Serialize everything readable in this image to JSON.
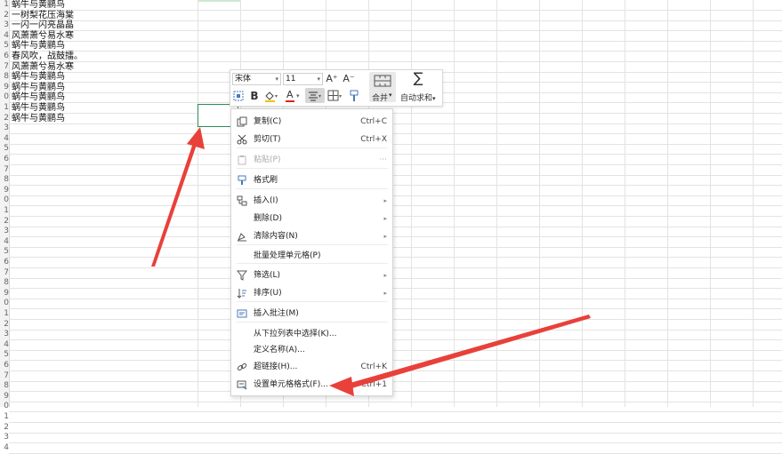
{
  "sheet": {
    "row_numbers": [
      "1",
      "2",
      "3",
      "4",
      "5",
      "6",
      "7",
      "8",
      "9",
      "0",
      "1",
      "2",
      "3",
      "4",
      "5",
      "6",
      "7",
      "8",
      "9",
      "0",
      "1",
      "2",
      "3",
      "4",
      "5",
      "6",
      "7",
      "8",
      "9",
      "0",
      "1",
      "2",
      "3",
      "4",
      "5",
      "6",
      "7",
      "8",
      "9",
      "0",
      "1",
      "2",
      "3",
      "4"
    ],
    "cells": [
      "蜗牛与黄鹂鸟",
      "一树梨花压海棠",
      "一闪一闪亮晶晶",
      "风萧萧兮易水寒",
      "蜗牛与黄鹂鸟",
      "春风吹，战鼓擂。",
      "风萧萧兮易水寒",
      "蜗牛与黄鹂鸟",
      "蜗牛与黄鹂鸟",
      "蜗牛与黄鹂鸟",
      "蜗牛与黄鹂鸟",
      "蜗牛与黄鹂鸟"
    ]
  },
  "minibar": {
    "font_name": "宋体",
    "font_size": "11",
    "increase_font": "A⁺",
    "decrease_font": "A⁻",
    "bold": "B",
    "font_color_letter": "A",
    "merge_label": "合并",
    "autosum_label": "自动求和",
    "sigma": "∑"
  },
  "menu": {
    "items": [
      {
        "label": "复制(C)",
        "shortcut": "Ctrl+C"
      },
      {
        "label": "剪切(T)",
        "shortcut": "Ctrl+X"
      },
      {
        "label": "粘贴(P)",
        "shortcut": "···"
      },
      {
        "label": "格式刷",
        "shortcut": ""
      },
      {
        "label": "插入(I)",
        "shortcut": ""
      },
      {
        "label": "删除(D)",
        "shortcut": ""
      },
      {
        "label": "清除内容(N)",
        "shortcut": ""
      },
      {
        "label": "批量处理单元格(P)",
        "shortcut": ""
      },
      {
        "label": "筛选(L)",
        "shortcut": ""
      },
      {
        "label": "排序(U)",
        "shortcut": ""
      },
      {
        "label": "插入批注(M)",
        "shortcut": ""
      },
      {
        "label": "从下拉列表中选择(K)...",
        "shortcut": ""
      },
      {
        "label": "定义名称(A)...",
        "shortcut": ""
      },
      {
        "label": "超链接(H)...",
        "shortcut": "Ctrl+K"
      },
      {
        "label": "设置单元格格式(F)...",
        "shortcut": "Ctrl+1"
      }
    ],
    "submenu_arrow": "▸"
  },
  "colors": {
    "annotation_arrow": "#e8413a",
    "selection_border": "#2e8b57"
  }
}
